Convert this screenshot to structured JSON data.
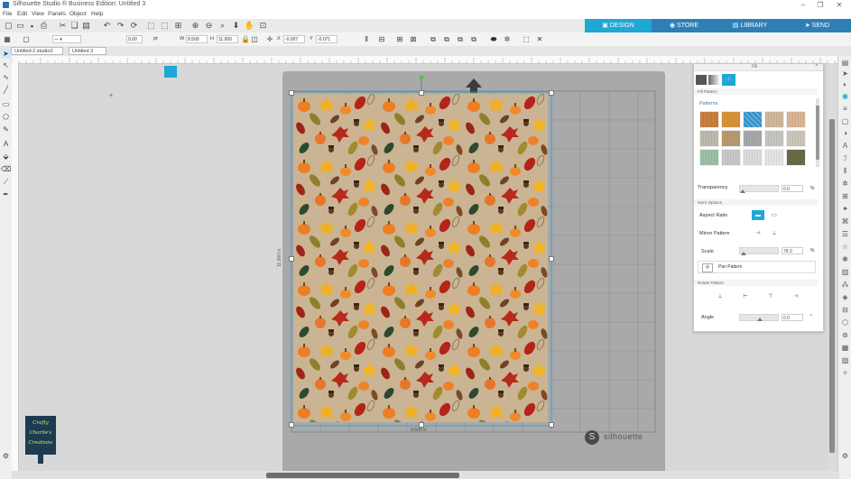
{
  "window": {
    "title": "Silhouette Studio ® Business Edition: Untitled 3",
    "controls": [
      "minimize-icon",
      "restore-icon",
      "close-icon"
    ]
  },
  "menu": [
    "File",
    "Edit",
    "View",
    "Panels",
    "Object",
    "Help"
  ],
  "nav_tabs": [
    {
      "label": "DESIGN",
      "active": true
    },
    {
      "label": "STORE",
      "active": false
    },
    {
      "label": "LIBRARY",
      "active": false
    },
    {
      "label": "SEND",
      "active": false
    }
  ],
  "property_bar": {
    "line_weight": "0.00",
    "line_unit": "pt",
    "width_label": "W",
    "width_value": "8.500",
    "height_label": "H",
    "height_value": "11.000",
    "x_label": "X",
    "x_value": "-0.007",
    "y_label": "Y",
    "y_value": "-0.071"
  },
  "doc_tabs": [
    "Untitled 2.studio3",
    "Untitled 3"
  ],
  "canvas": {
    "width_label": "8.500 in",
    "height_label": "11.000 in",
    "brand": "silhouette"
  },
  "fill_panel": {
    "title": "Fill",
    "fill_pattern_section": "Fill Pattern",
    "patterns_label": "Patterns",
    "transparency_label": "Transparency",
    "transparency_value": "0.0",
    "transparency_unit": "%",
    "more_options_section": "More Options",
    "aspect_ratio_label": "Aspect Ratio",
    "mirror_pattern_label": "Mirror Pattern",
    "scale_label": "Scale",
    "scale_value": "78.0",
    "scale_unit": "%",
    "pan_pattern_label": "Pan Pattern",
    "rotate_section": "Rotate Pattern",
    "angle_label": "Angle",
    "angle_value": "0.0",
    "angle_unit": "°",
    "pattern_swatches": [
      "#c9803e",
      "#d9923a",
      "#2f8fc6",
      "#cdb89a",
      "#d8b595",
      "#bfb8ad",
      "#b9996e",
      "#a6a9ab",
      "#c5c5c2",
      "#ccc5bb",
      "#9cc0a4",
      "#c8c8c8",
      "#dcdcdc",
      "#e4e4e4",
      "#6b6a46"
    ]
  },
  "logo": {
    "line1": "Crafty",
    "line2": "Charlie's",
    "line3": "Creations"
  },
  "colors": {
    "nav_bg": "#2f7fb7",
    "nav_active": "#1fa7d6",
    "page_bg": "#cbb493",
    "mat": "#a9a9a9",
    "selection": "#1fa7d6"
  }
}
